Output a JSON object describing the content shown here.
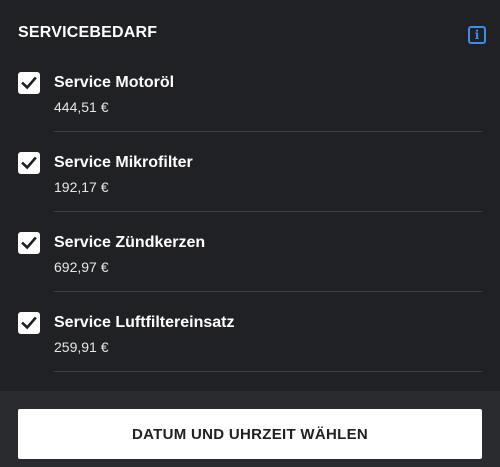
{
  "header": {
    "title": "SERVICEBEDARF",
    "info_icon": "info-icon",
    "info_symbol": "i"
  },
  "colors": {
    "background": "#202124",
    "accent": "#3a8ee6",
    "button_bg": "#ffffff",
    "button_text": "#202124"
  },
  "services": [
    {
      "label": "Service Motoröl",
      "price": "444,51 €",
      "checked": true
    },
    {
      "label": "Service Mikrofilter",
      "price": "192,17 €",
      "checked": true
    },
    {
      "label": "Service Zündkerzen",
      "price": "692,97 €",
      "checked": true
    },
    {
      "label": "Service Luftfiltereinsatz",
      "price": "259,91 €",
      "checked": true
    }
  ],
  "footer": {
    "cta_label": "DATUM UND UHRZEIT WÄHLEN"
  }
}
